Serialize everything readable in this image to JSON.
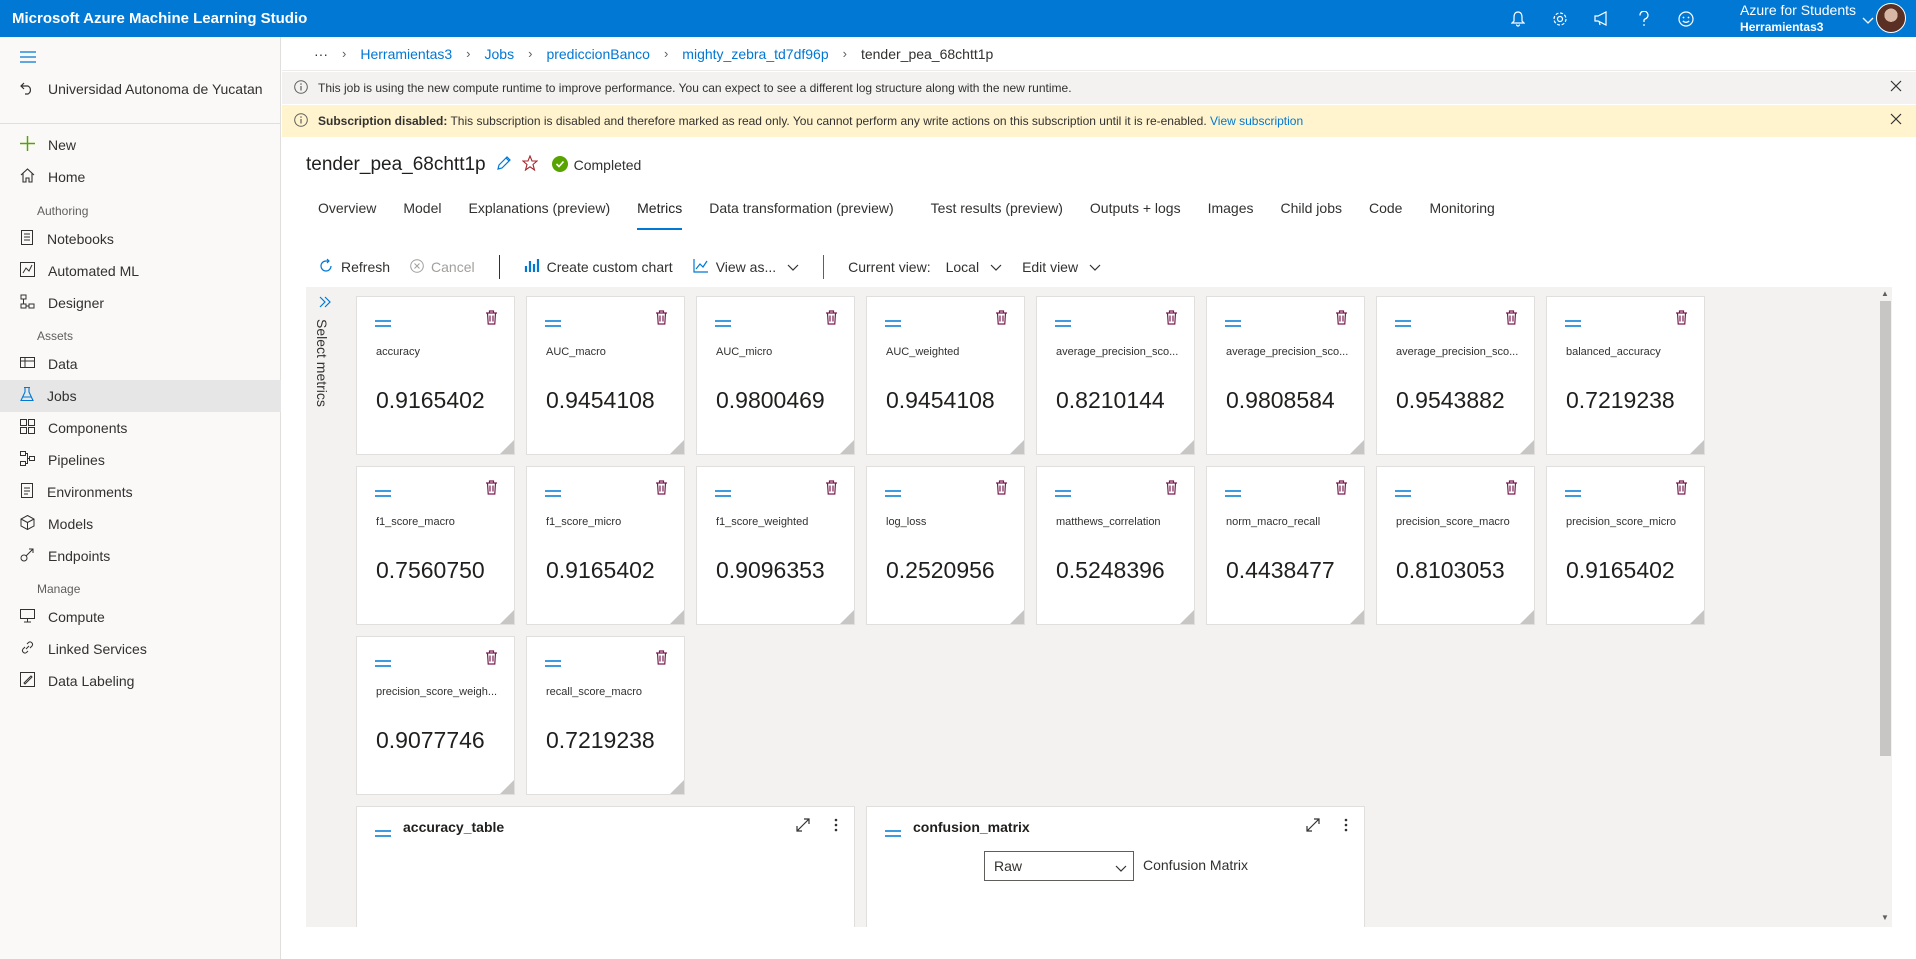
{
  "app": {
    "title": "Microsoft Azure Machine Learning Studio"
  },
  "account": {
    "name": "Azure for Students",
    "directory": "Herramientas3"
  },
  "top_icons": [
    "bell-icon",
    "gear-icon",
    "megaphone-icon",
    "help-icon",
    "smiley-icon"
  ],
  "sidebar": {
    "workspace": "Universidad Autonoma de Yucatan",
    "items": [
      {
        "label": "New",
        "icon": "plus-icon"
      },
      {
        "label": "Home",
        "icon": "home-icon"
      }
    ],
    "sections": {
      "authoring": "Authoring",
      "assets": "Assets",
      "manage": "Manage"
    },
    "authoring_items": [
      {
        "label": "Notebooks",
        "icon": "notebook-icon"
      },
      {
        "label": "Automated ML",
        "icon": "automl-icon"
      },
      {
        "label": "Designer",
        "icon": "designer-icon"
      }
    ],
    "assets_items": [
      {
        "label": "Data",
        "icon": "data-icon"
      },
      {
        "label": "Jobs",
        "icon": "flask-icon"
      },
      {
        "label": "Components",
        "icon": "components-icon"
      },
      {
        "label": "Pipelines",
        "icon": "pipeline-icon"
      },
      {
        "label": "Environments",
        "icon": "environment-icon"
      },
      {
        "label": "Models",
        "icon": "cube-icon"
      },
      {
        "label": "Endpoints",
        "icon": "endpoint-icon"
      }
    ],
    "manage_items": [
      {
        "label": "Compute",
        "icon": "compute-icon"
      },
      {
        "label": "Linked Services",
        "icon": "link-icon"
      },
      {
        "label": "Data Labeling",
        "icon": "labeling-icon"
      }
    ]
  },
  "breadcrumb": {
    "ellipsis": "···",
    "items": [
      "Herramientas3",
      "Jobs",
      "prediccionBanco",
      "mighty_zebra_td7df96p"
    ],
    "current": "tender_pea_68chtt1p"
  },
  "banners": {
    "info": "This job is using the new compute runtime to improve performance. You can expect to see a different log structure along with the new runtime.",
    "warn_bold": "Subscription disabled:",
    "warn_text": " This subscription is disabled and therefore marked as read only. You cannot perform any write actions on this subscription until it is re-enabled. ",
    "warn_link": "View subscription"
  },
  "job": {
    "name": "tender_pea_68chtt1p",
    "status": "Completed"
  },
  "tabs": [
    "Overview",
    "Model",
    "Explanations (preview)",
    "Metrics",
    "Data transformation (preview)",
    "Test results (preview)",
    "Outputs + logs",
    "Images",
    "Child jobs",
    "Code",
    "Monitoring"
  ],
  "active_tab": "Metrics",
  "toolbar": {
    "refresh": "Refresh",
    "cancel": "Cancel",
    "create_chart": "Create custom chart",
    "view_as": "View as...",
    "current_view_label": "Current view:",
    "current_view_value": "Local",
    "edit_view": "Edit view"
  },
  "select_metrics": "Select metrics",
  "metrics": [
    {
      "name": "accuracy",
      "value": "0.9165402"
    },
    {
      "name": "AUC_macro",
      "value": "0.9454108"
    },
    {
      "name": "AUC_micro",
      "value": "0.9800469"
    },
    {
      "name": "AUC_weighted",
      "value": "0.9454108"
    },
    {
      "name": "average_precision_sco...",
      "value": "0.8210144"
    },
    {
      "name": "average_precision_sco...",
      "value": "0.9808584"
    },
    {
      "name": "average_precision_sco...",
      "value": "0.9543882"
    },
    {
      "name": "balanced_accuracy",
      "value": "0.7219238"
    },
    {
      "name": "f1_score_macro",
      "value": "0.7560750"
    },
    {
      "name": "f1_score_micro",
      "value": "0.9165402"
    },
    {
      "name": "f1_score_weighted",
      "value": "0.9096353"
    },
    {
      "name": "log_loss",
      "value": "0.2520956"
    },
    {
      "name": "matthews_correlation",
      "value": "0.5248396"
    },
    {
      "name": "norm_macro_recall",
      "value": "0.4438477"
    },
    {
      "name": "precision_score_macro",
      "value": "0.8103053"
    },
    {
      "name": "precision_score_micro",
      "value": "0.9165402"
    },
    {
      "name": "precision_score_weigh...",
      "value": "0.9077746"
    },
    {
      "name": "recall_score_macro",
      "value": "0.7219238"
    }
  ],
  "charts": [
    {
      "title": "accuracy_table"
    },
    {
      "title": "confusion_matrix",
      "select_value": "Raw",
      "label": "Confusion Matrix"
    }
  ],
  "colors": {
    "brand": "#0078d4",
    "success": "#57a300",
    "delete": "#7a1a4f"
  }
}
